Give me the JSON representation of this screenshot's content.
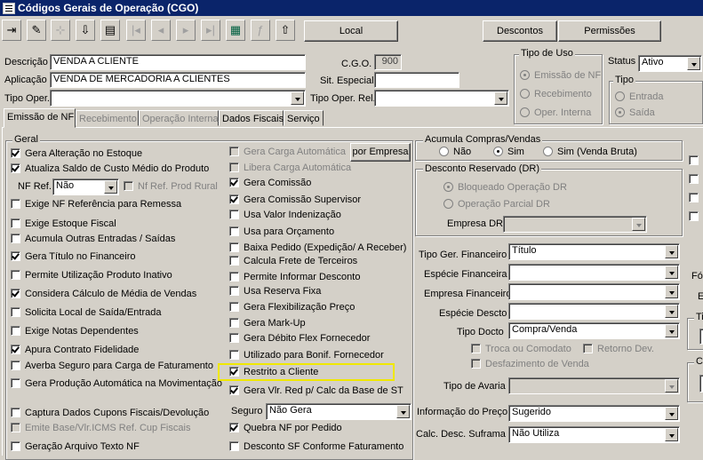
{
  "window": {
    "title": "Códigos Gerais de Operação (CGO)"
  },
  "toolbar": {
    "icons": [
      "exit-icon",
      "edit-icon",
      "tree-icon",
      "save-icon",
      "print-icon",
      "first-icon",
      "prev-icon",
      "next-icon",
      "last-icon",
      "grid-icon",
      "text-icon",
      "export-icon"
    ],
    "local_label": "Local",
    "descontos_label": "Descontos",
    "permissoes_label": "Permissões"
  },
  "header": {
    "descricao_label": "Descrição",
    "descricao_value": "VENDA A CLIENTE",
    "aplicacao_label": "Aplicação",
    "aplicacao_value": "VENDA DE MERCADORIA A CLIENTES",
    "tipo_oper_label": "Tipo Oper.",
    "tipo_oper_value": "",
    "cgo_label": "C.G.O.",
    "cgo_value": "900",
    "sit_especial_label": "Sit. Especial",
    "sit_especial_value": "",
    "tipo_oper_rel_label": "Tipo Oper. Rel.",
    "tipo_oper_rel_value": "",
    "tipo_uso_title": "Tipo de Uso",
    "tipo_uso_options": [
      "Emissão de NF",
      "Recebimento",
      "Oper. Interna"
    ],
    "status_label": "Status",
    "status_value": "Ativo",
    "tipo_title": "Tipo",
    "tipo_options": [
      "Entrada",
      "Saída"
    ]
  },
  "tabs": [
    "Emissão de NF",
    "Recebimento",
    "Operação Interna",
    "Dados Fiscais",
    "Serviço"
  ],
  "geral": {
    "title": "Geral",
    "col1": [
      "Gera Alteração no Estoque",
      "Atualiza Saldo de Custo Médio do Produto",
      "Exige NF Referência para Remessa",
      "Exige Estoque Fiscal",
      "Acumula Outras Entradas / Saídas",
      "Gera Título no Financeiro",
      "Permite Utilização Produto Inativo",
      "Considera Cálculo de Média de Vendas",
      "Solicita Local de Saída/Entrada",
      "Exige Notas Dependentes",
      "Apura Contrato Fidelidade",
      "Averba Seguro para Carga de Faturamento",
      "Gera Produção Automática na Movimentação",
      "Captura Dados Cupons Fiscais/Devolução",
      "Emite Base/Vlr.ICMS Ref. Cup Fiscais",
      "Geração Arquivo Texto NF"
    ],
    "nf_ref_label": "NF Ref.",
    "nf_ref_value": "Não",
    "nf_ref_prod_rural": "Nf Ref. Prod Rural",
    "col2": [
      "Gera Carga Automática",
      "Libera Carga Automática",
      "Gera Comissão",
      "Gera Comissão Supervisor",
      "Usa Valor Indenização",
      "Usa para Orçamento",
      "Baixa Pedido (Expedição/ A Receber)",
      "Calcula Frete de Terceiros",
      "Permite Informar Desconto",
      "Usa Reserva Fixa",
      "Gera Flexibilização Preço",
      "Gera Mark-Up",
      "Gera Débito Flex Fornecedor",
      "Utilizado para Bonif. Fornecedor",
      "Restrito a Cliente",
      "Gera Vlr. Red p/ Calc da Base de ST",
      "Quebra NF por Pedido",
      "Desconto SF Conforme Faturamento"
    ],
    "por_empresa_label": "por Empresa",
    "seguro_label": "Seguro",
    "seguro_value": "Não Gera"
  },
  "acumula": {
    "title": "Acumula Compras/Vendas",
    "options": [
      "Não",
      "Sim",
      "Sim (Venda Bruta)"
    ]
  },
  "desconto": {
    "title": "Desconto Reservado (DR)",
    "options": [
      "Bloqueado Operação DR",
      "Operação Parcial DR"
    ],
    "empresa_dr_label": "Empresa DR",
    "empresa_dr_value": ""
  },
  "fin": {
    "tipo_ger_fin_label": "Tipo Ger. Financeiro",
    "tipo_ger_fin_value": "Título",
    "especie_fin_label": "Espécie Financeira",
    "especie_fin_value": "",
    "empresa_fin_label": "Empresa Financeiro",
    "empresa_fin_value": "",
    "especie_desc_label": "Espécie Descto",
    "especie_desc_value": "",
    "tipo_docto_label": "Tipo Docto",
    "tipo_docto_value": "Compra/Venda",
    "troca_label": "Troca ou Comodato",
    "retorno_label": "Retorno Dev.",
    "desfaz_label": "Desfazimento de Venda",
    "tipo_avaria_label": "Tipo de Avaria",
    "tipo_avaria_value": "",
    "info_preco_label": "Informação do Preço",
    "info_preco_value": "Sugerido",
    "calc_desc_label": "Calc. Desc. Suframa",
    "calc_desc_value": "Não Utiliza"
  },
  "right_edge": {
    "fo": "Fó",
    "e": "E",
    "ti": "Ti",
    "c": "C"
  }
}
